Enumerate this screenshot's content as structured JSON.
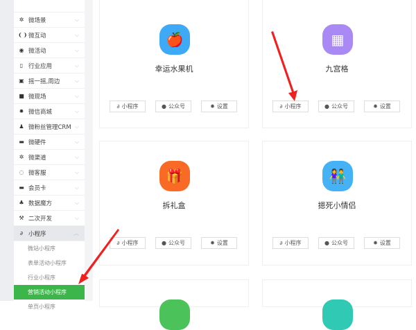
{
  "sidebar": {
    "items": [
      {
        "label": "微场景",
        "icon": "scene-icon"
      },
      {
        "label": "微互动",
        "icon": "interact-icon"
      },
      {
        "label": "微活动",
        "icon": "activity-icon"
      },
      {
        "label": "行业应用",
        "icon": "industry-icon"
      },
      {
        "label": "摇一摇,周边",
        "icon": "shake-icon"
      },
      {
        "label": "微现场",
        "icon": "video-icon"
      },
      {
        "label": "微信商城",
        "icon": "gear-icon"
      },
      {
        "label": "微粉丝管理CRM",
        "icon": "fans-icon"
      },
      {
        "label": "微硬件",
        "icon": "hardware-icon"
      },
      {
        "label": "微渠道",
        "icon": "channel-icon"
      },
      {
        "label": "微客服",
        "icon": "service-icon"
      },
      {
        "label": "会员卡",
        "icon": "card-icon"
      },
      {
        "label": "数据魔方",
        "icon": "data-icon"
      },
      {
        "label": "二次开发",
        "icon": "wrench-icon"
      }
    ],
    "open": {
      "label": "小程序",
      "icon": "link-icon"
    },
    "sub": [
      "微站小程序",
      "表单活动小程序",
      "行业小程序",
      "营销活动小程序",
      "单页小程序"
    ]
  },
  "buttons": {
    "miniapp": "小程序",
    "official": "公众号",
    "settings": "设置"
  },
  "cards": [
    {
      "title": "幸运水果机",
      "color": "#3ea9f5",
      "glyph": "🍎"
    },
    {
      "title": "九宫格",
      "color": "#a98af5",
      "glyph": "▦"
    },
    {
      "title": "拆礼盒",
      "color": "#f86a26",
      "glyph": "🎁"
    },
    {
      "title": "摁死小情侣",
      "color": "#44b2f5",
      "glyph": "👫"
    }
  ]
}
